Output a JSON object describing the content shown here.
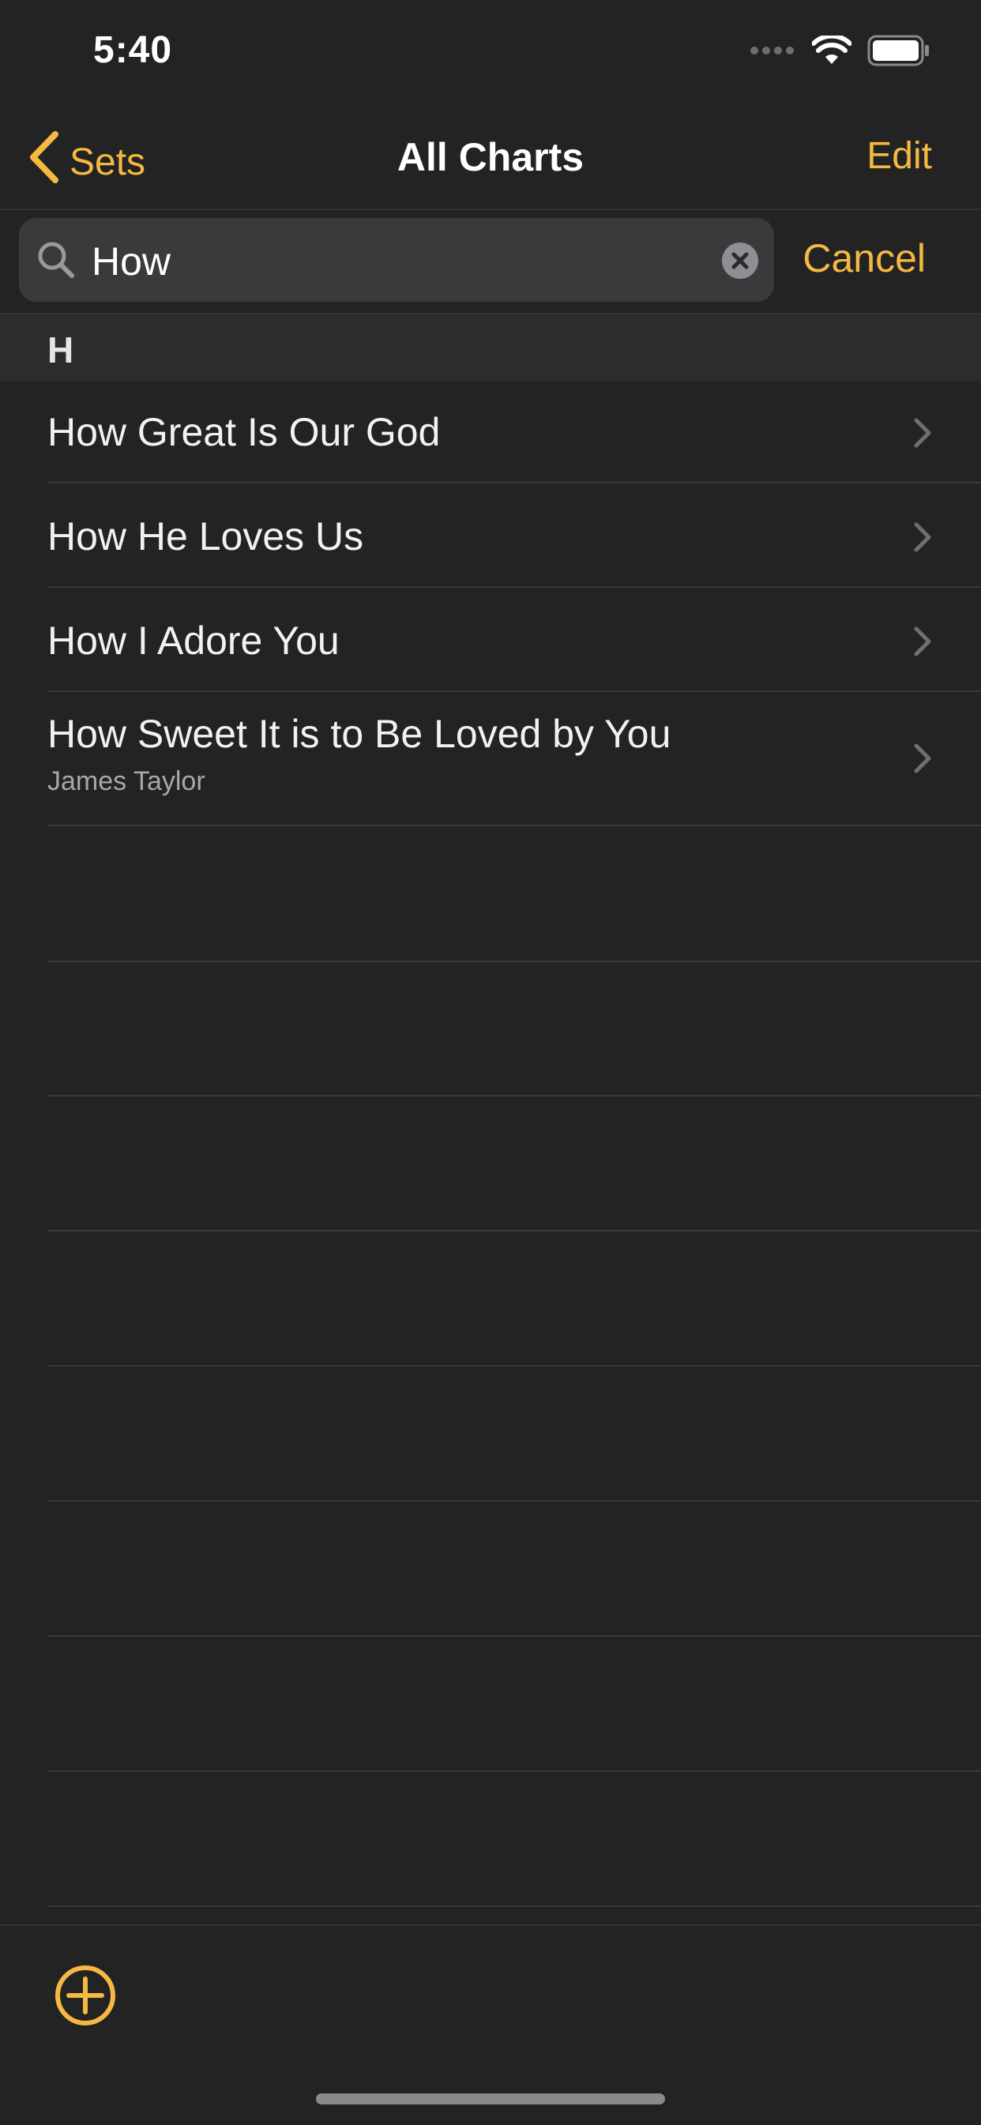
{
  "status_bar": {
    "time": "5:40"
  },
  "nav": {
    "back_label": "Sets",
    "title": "All Charts",
    "edit_label": "Edit"
  },
  "search": {
    "value": "How",
    "cancel_label": "Cancel"
  },
  "section": {
    "letter": "H"
  },
  "items": [
    {
      "title": "How Great Is Our God",
      "subtitle": ""
    },
    {
      "title": "How He Loves Us",
      "subtitle": ""
    },
    {
      "title": "How I Adore You",
      "subtitle": ""
    },
    {
      "title": "How Sweet It is to Be Loved by You",
      "subtitle": "James Taylor"
    }
  ],
  "colors": {
    "accent": "#F5B942",
    "background": "#232323",
    "field": "#3a3a3c"
  },
  "icons": {
    "back": "chevron-left-icon",
    "search": "search-icon",
    "clear": "clear-icon",
    "row": "chevron-right-icon",
    "add": "plus-circle-icon"
  }
}
